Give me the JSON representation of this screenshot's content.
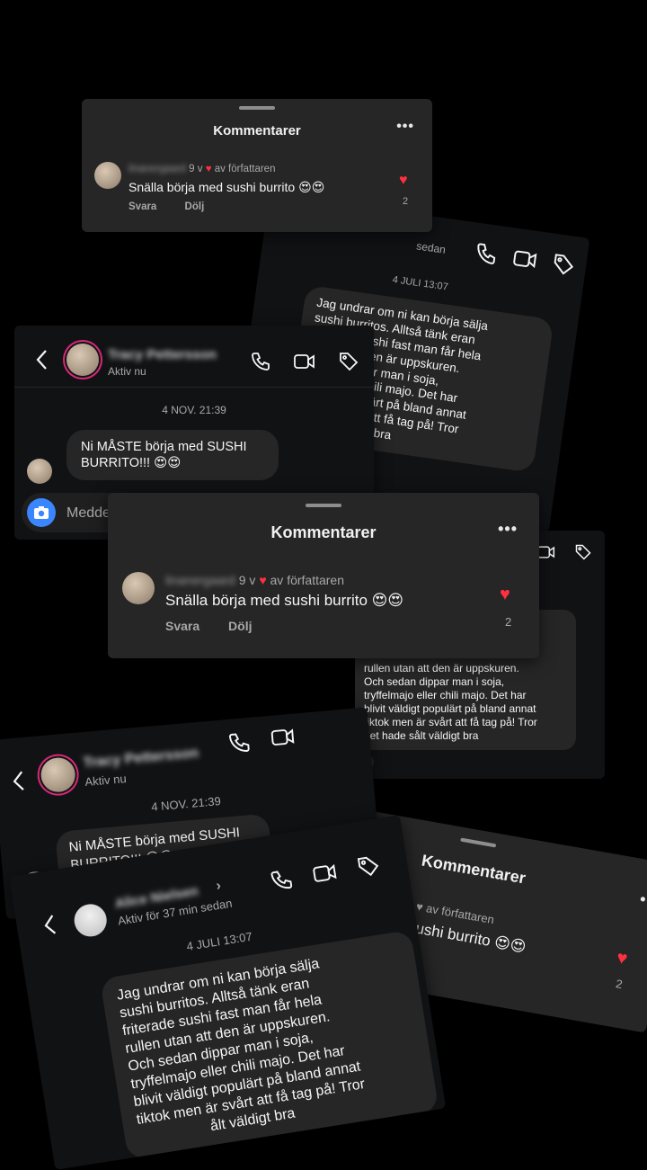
{
  "comments_title": "Kommentarer",
  "comment": {
    "username": "linanergaard",
    "age": "9 v",
    "heart": "♥",
    "by_author": "av författaren",
    "text": "Snälla börja med sushi burrito",
    "emojis": "😍😍",
    "reply": "Svara",
    "hide": "Dölj",
    "likes": "2"
  },
  "dm_tracy": {
    "name": "Tracy Pettersson",
    "status": "Aktiv nu",
    "date": "4 NOV. 21:39",
    "message": "Ni MÅSTE börja med SUSHI BURRITO!!!",
    "emojis": "😍😍",
    "composer_placeholder": "Meddelande..."
  },
  "dm_alice": {
    "name": "Alice Nielsen",
    "chevron": "›",
    "status": "Aktiv för 37 min sedan",
    "status_partial": "sedan",
    "date": "4 JULI 13:07",
    "lines": [
      "Jag undrar om ni kan börja sälja",
      "sushi burritos. Alltså tänk eran",
      "friterade sushi fast man får hela",
      "rullen utan att den är uppskuren.",
      "Och sedan dippar man i soja,",
      "tryffelmajo eller chili majo. Det har",
      "blivit väldigt populärt på bland annat",
      "tiktok men är svårt att få tag på! Tror",
      "det hade sålt väldigt bra"
    ],
    "partial_top": [
      "Jag undrar om ni kan börja sälja",
      "sushi burritos. Alltså tänk eran",
      "friterade sushi fast man får hela",
      "att den är uppskuren.",
      "dippar man i soja,",
      "ller chili majo. Det har",
      "populärt på bland annat",
      "svårt att få tag på! Tror",
      "väldigt bra"
    ],
    "partial_bottom": [
      "Jag undrar om ni kan börja sälja",
      "sushi burritos. Alltså tänk eran",
      "friterade sushi fast man får hela",
      "rullen utan att den är uppskuren.",
      "Och sedan dippar man i soja,",
      "tryffelmajo eller chili majo. Det har",
      "blivit väldigt populärt på bland annat",
      "tiktok men är svårt att få tag på! Tror",
      "ålt väldigt bra"
    ],
    "reaction": "❤"
  },
  "partial_comment": {
    "by_author": "y • ♥ av författaren",
    "text": "ed sushi burrito",
    "likes": "2"
  },
  "colors": {
    "background": "#000000",
    "card": "#262626",
    "dm": "#111214",
    "heart": "#ff3040",
    "camera": "#3a86ff"
  }
}
